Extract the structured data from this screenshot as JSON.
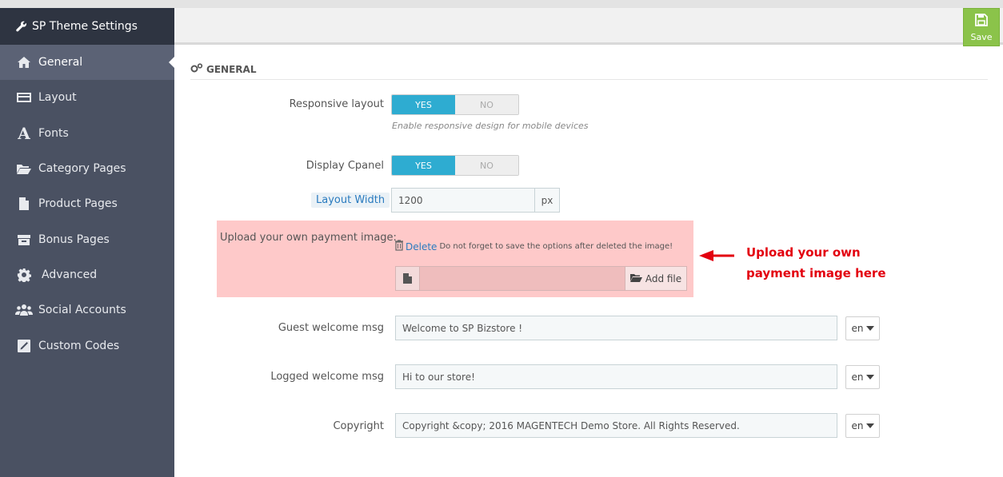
{
  "sidebar": {
    "header": "SP Theme Settings",
    "items": [
      {
        "label": "General",
        "icon": "home-icon"
      },
      {
        "label": "Layout",
        "icon": "layout-icon"
      },
      {
        "label": "Fonts",
        "icon": "font-icon"
      },
      {
        "label": "Category Pages",
        "icon": "folder-open-icon"
      },
      {
        "label": "Product Pages",
        "icon": "file-icon"
      },
      {
        "label": "Bonus Pages",
        "icon": "archive-icon"
      },
      {
        "label": "Advanced",
        "icon": "gear-icon"
      },
      {
        "label": "Social Accounts",
        "icon": "users-icon"
      },
      {
        "label": "Custom Codes",
        "icon": "pencil-icon"
      }
    ]
  },
  "toolbar": {
    "save_label": "Save"
  },
  "section": {
    "title": "GENERAL"
  },
  "fields": {
    "responsive_layout": {
      "label": "Responsive layout",
      "yes": "YES",
      "no": "NO",
      "value": "YES",
      "help": "Enable responsive design for mobile devices"
    },
    "display_cpanel": {
      "label": "Display Cpanel",
      "yes": "YES",
      "no": "NO",
      "value": "YES"
    },
    "layout_width": {
      "label": "Layout Width",
      "value": "1200",
      "unit": "px"
    },
    "payment_image": {
      "label": "Upload your own payment image:",
      "delete_label": "Delete",
      "delete_note": "Do not forget to save the options after deleted the image!",
      "add_file_label": "Add file"
    },
    "guest_welcome": {
      "label": "Guest welcome msg",
      "value": "Welcome to SP Bizstore !",
      "lang": "en"
    },
    "logged_welcome": {
      "label": "Logged welcome msg",
      "value": "Hi to our store!",
      "lang": "en"
    },
    "copyright": {
      "label": "Copyright",
      "value": "Copyright &copy; 2016 MAGENTECH Demo Store. All Rights Reserved.",
      "lang": "en"
    }
  },
  "annotation": {
    "line1": "Upload your own",
    "line2": "payment image here"
  },
  "colors": {
    "sidebar": "#4a5162",
    "sidebar_header": "#2e3441",
    "switch_on": "#2eacd1",
    "save": "#8bc34a",
    "highlight": "#fec9c9",
    "annotation": "#e3000f"
  }
}
